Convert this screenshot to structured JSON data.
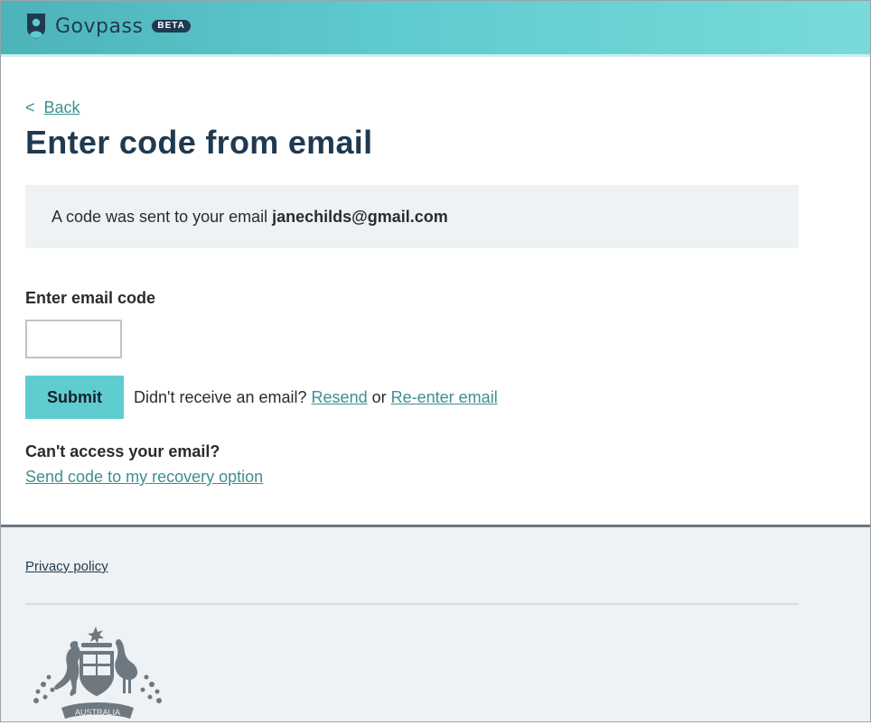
{
  "header": {
    "brand": "Govpass",
    "badge": "BETA"
  },
  "nav": {
    "back_chevron": "<",
    "back_label": "Back"
  },
  "page": {
    "title": "Enter code from email"
  },
  "info": {
    "prefix": "A code was sent to your email",
    "email": "janechilds@gmail.com"
  },
  "form": {
    "code_label": "Enter email code",
    "code_value": "",
    "submit_label": "Submit",
    "no_email_prompt": "Didn't receive an email?",
    "resend_label": "Resend",
    "or_text": "or",
    "reenter_label": "Re-enter email"
  },
  "recovery": {
    "heading": "Can't access your email?",
    "link_label": "Send code to my recovery option"
  },
  "footer": {
    "privacy_label": "Privacy policy",
    "crest_text": "AUSTRALIA"
  },
  "colors": {
    "header_gradient_start": "#4cb3b9",
    "header_gradient_end": "#79dad9",
    "title": "#1f3a50",
    "link": "#3d8f92",
    "button": "#5fcdd0",
    "panel": "#eef2f5"
  },
  "icons": {
    "brand": "shield-person-icon",
    "footer": "coat-of-arms-icon"
  }
}
